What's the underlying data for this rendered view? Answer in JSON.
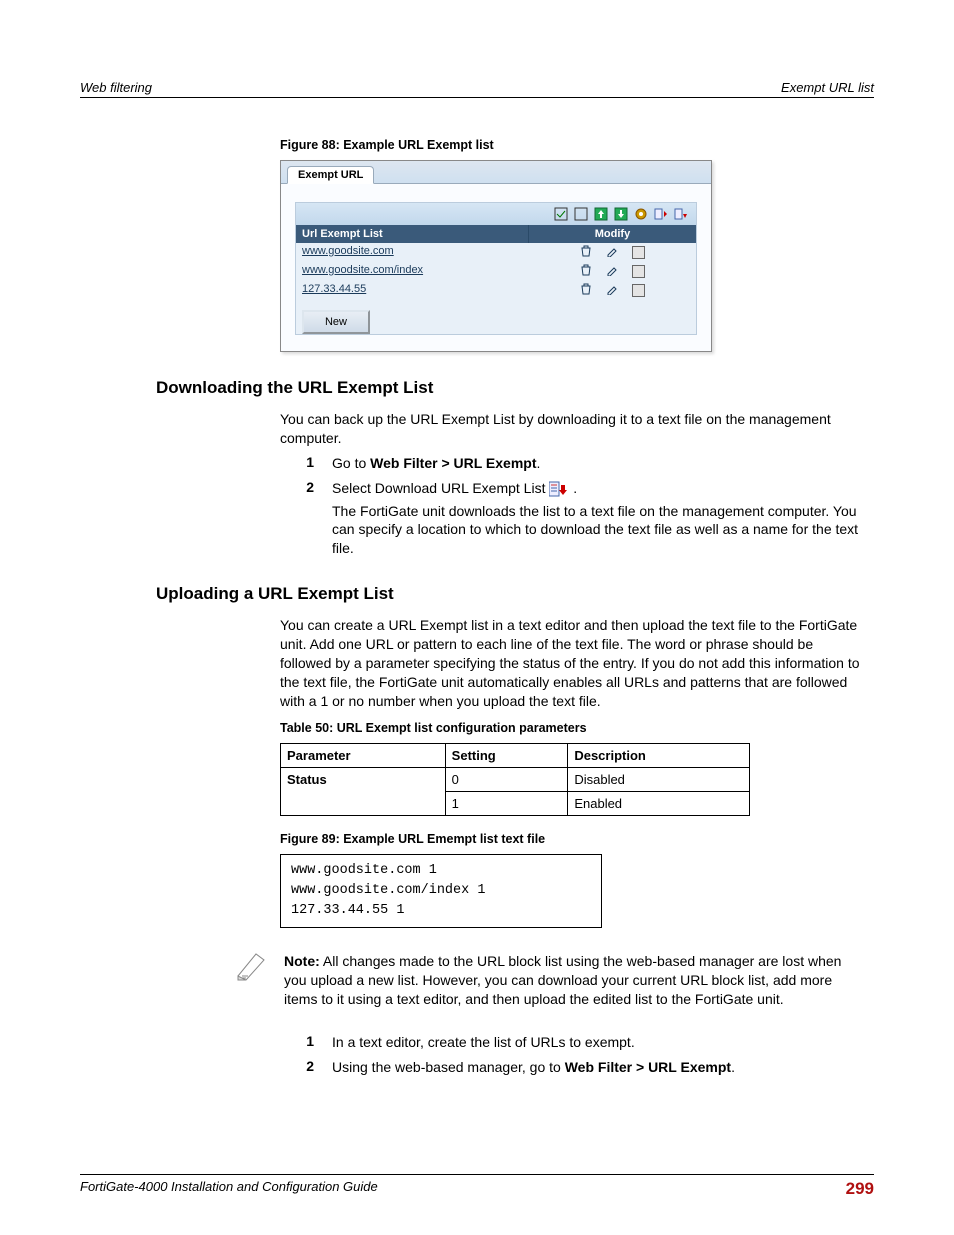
{
  "header": {
    "left": "Web filtering",
    "right": "Exempt URL list"
  },
  "figure88": {
    "caption": "Figure 88: Example URL Exempt list",
    "tab": "Exempt URL",
    "col1": "Url Exempt List",
    "col2": "Modify",
    "rows": [
      "www.goodsite.com",
      "www.goodsite.com/index",
      "127.33.44.55"
    ],
    "new_btn": "New"
  },
  "section1": {
    "title": "Downloading the URL Exempt List",
    "intro": "You can back up the URL Exempt List by downloading it to a text file on the management computer.",
    "step1_pre": "Go to ",
    "step1_bold": "Web Filter > URL Exempt",
    "step1_post": ".",
    "step2a": "Select Download URL Exempt List ",
    "step2b": ".",
    "step2_more": "The FortiGate unit downloads the list to a text file on the management computer. You can specify a location to which to download the text file as well as a name for the text file."
  },
  "section2": {
    "title": "Uploading a URL Exempt List",
    "intro": "You can create a URL Exempt list in a text editor and then upload the text file to the FortiGate unit. Add one URL or pattern to each line of the text file. The word or phrase should be followed by a parameter specifying the status of the entry. If you do not add this information to the text file, the FortiGate unit automatically enables all URLs and patterns that are followed with a 1 or no number when you upload the text file."
  },
  "table50": {
    "caption": "Table 50: URL Exempt list configuration parameters",
    "h_param": "Parameter",
    "h_setting": "Setting",
    "h_desc": "Description",
    "param": "Status",
    "r0_s": "0",
    "r0_d": "Disabled",
    "r1_s": "1",
    "r1_d": "Enabled"
  },
  "figure89": {
    "caption": "Figure 89: Example URL Emempt list text file",
    "l1": "www.goodsite.com 1",
    "l2": "www.goodsite.com/index 1",
    "l3": "127.33.44.55 1"
  },
  "note": {
    "label": "Note:",
    "text": " All changes made to the URL block list using the web-based manager are lost when you upload a new list. However, you can download your current URL block list, add more items to it using a text editor, and then upload the edited list to the FortiGate unit."
  },
  "steps_b": {
    "s1": "In a text editor, create the list of URLs to exempt.",
    "s2_pre": "Using the web-based manager, go to ",
    "s2_bold": "Web Filter > URL Exempt",
    "s2_post": "."
  },
  "footer": {
    "guide": "FortiGate-4000 Installation and Configuration Guide",
    "page": "299"
  }
}
